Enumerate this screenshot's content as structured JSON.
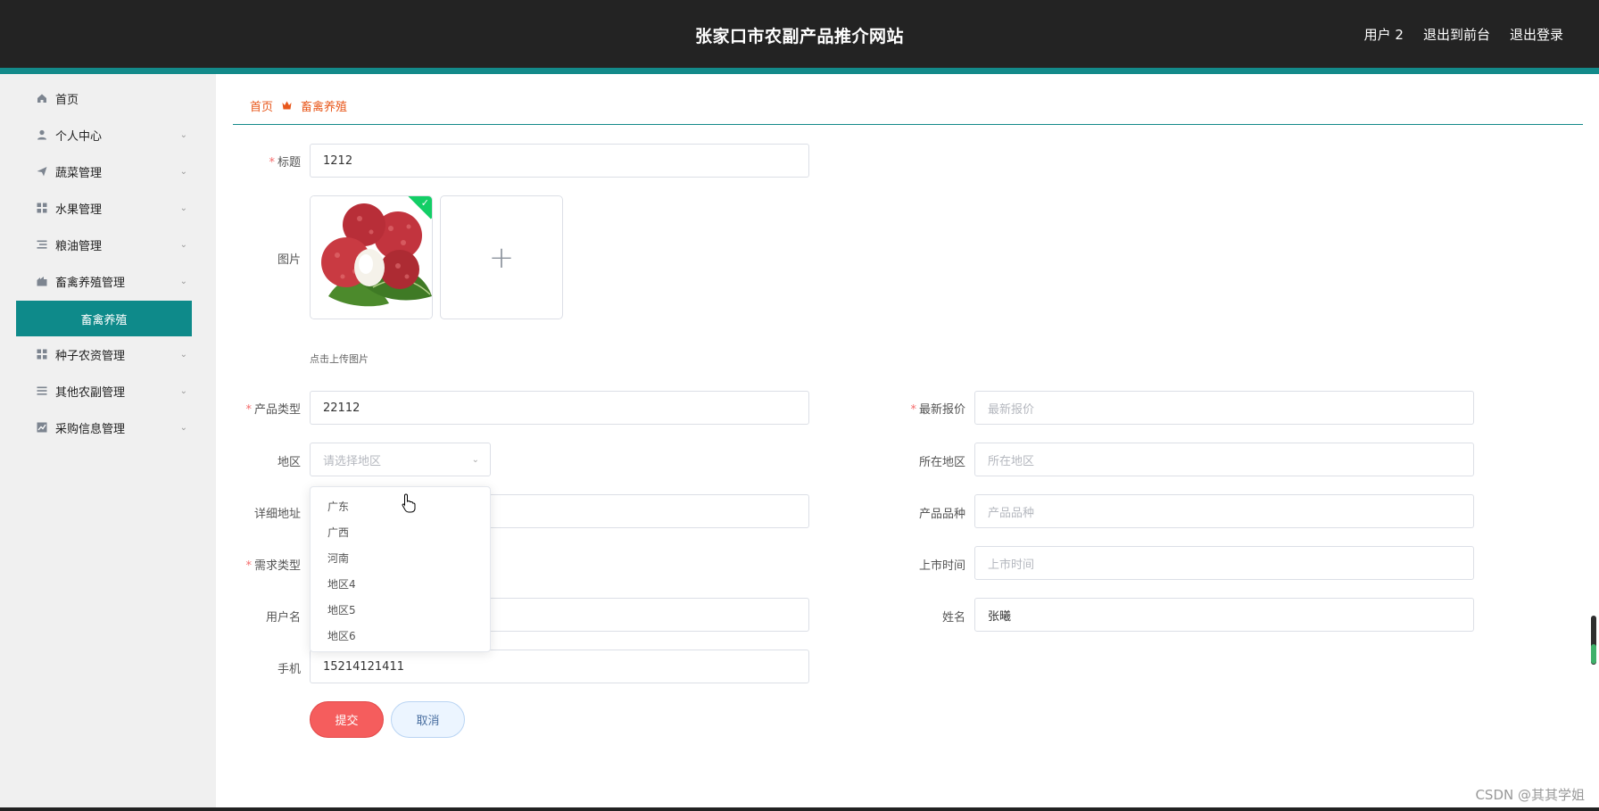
{
  "header": {
    "title": "张家口市农副产品推介网站",
    "user": "用户 2",
    "back_front": "退出到前台",
    "logout": "退出登录"
  },
  "sidebar": {
    "items": [
      {
        "label": "首页",
        "icon": "home-icon"
      },
      {
        "label": "个人中心",
        "icon": "user-icon"
      },
      {
        "label": "蔬菜管理",
        "icon": "send-icon"
      },
      {
        "label": "水果管理",
        "icon": "grid-icon"
      },
      {
        "label": "粮油管理",
        "icon": "list-icon"
      },
      {
        "label": "畜禽养殖管理",
        "icon": "shop-icon"
      },
      {
        "label": "种子农资管理",
        "icon": "grid-icon"
      },
      {
        "label": "其他农副管理",
        "icon": "menu-icon"
      },
      {
        "label": "采购信息管理",
        "icon": "chart-icon"
      }
    ],
    "active_submenu": "畜禽养殖"
  },
  "breadcrumb": {
    "home": "首页",
    "current": "畜禽养殖"
  },
  "form": {
    "title": {
      "label": "标题",
      "value": "1212"
    },
    "image": {
      "label": "图片",
      "tip": "点击上传图片"
    },
    "product_type": {
      "label": "产品类型",
      "value": "22112"
    },
    "latest_price": {
      "label": "最新报价",
      "placeholder": "最新报价"
    },
    "region": {
      "label": "地区",
      "placeholder": "请选择地区"
    },
    "location": {
      "label": "所在地区",
      "placeholder": "所在地区"
    },
    "address": {
      "label": "详细地址"
    },
    "variety": {
      "label": "产品品种",
      "placeholder": "产品品种"
    },
    "demand_type": {
      "label": "需求类型"
    },
    "launch_time": {
      "label": "上市时间",
      "placeholder": "上市时间"
    },
    "username": {
      "label": "用户名"
    },
    "name": {
      "label": "姓名",
      "value": "张曦"
    },
    "phone": {
      "label": "手机",
      "value": "15214121411"
    },
    "submit": "提交",
    "cancel": "取消"
  },
  "region_options": [
    "广东",
    "广西",
    "河南",
    "地区4",
    "地区5",
    "地区6"
  ],
  "watermark": "CSDN @其其学姐",
  "colors": {
    "header_bg": "#232323",
    "accent": "#138a8a",
    "breadcrumb": "#e8581c",
    "submit": "#f55d5d"
  }
}
